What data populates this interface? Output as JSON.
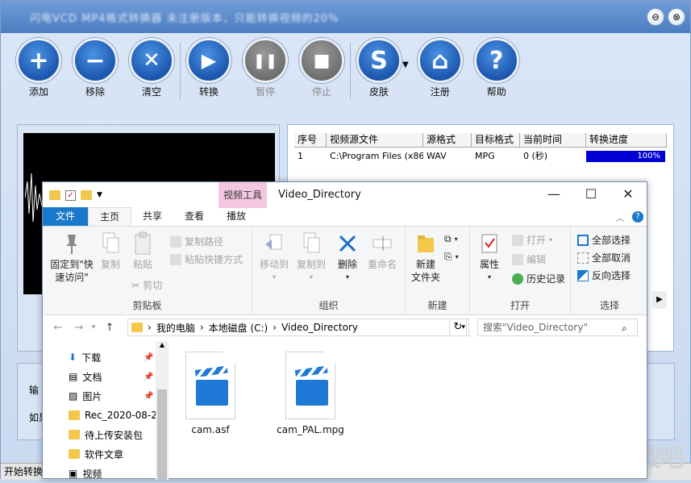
{
  "app": {
    "title": "闪电VCD MP4格式转换器 未注册版本，只能转换视频的20%",
    "close_min": "⊖",
    "close_x": "⊗"
  },
  "toolbar": [
    {
      "label": "添加",
      "glyph": "+",
      "disabled": false
    },
    {
      "label": "移除",
      "glyph": "−",
      "disabled": false
    },
    {
      "label": "清空",
      "glyph": "✕",
      "disabled": false
    },
    {
      "label": "转换",
      "glyph": "▶",
      "disabled": false
    },
    {
      "label": "暂停",
      "glyph": "❚❚",
      "disabled": true
    },
    {
      "label": "停止",
      "glyph": "■",
      "disabled": true
    },
    {
      "label": "皮肤",
      "glyph": "S",
      "disabled": false
    },
    {
      "label": "注册",
      "glyph": "⌂",
      "disabled": false
    },
    {
      "label": "帮助",
      "glyph": "?",
      "disabled": false
    }
  ],
  "table": {
    "headers": [
      "序号",
      "视频源文件",
      "源格式",
      "目标格式",
      "当前时间",
      "转换进度"
    ],
    "rows": [
      {
        "no": "1",
        "src": "C:\\Program Files (x86)...",
        "srcfmt": "WAV",
        "dstfmt": "MPG",
        "time": "0 (秒)",
        "progress": "100%",
        "progress_value": 1.0
      }
    ]
  },
  "bottom": {
    "label1": "输",
    "label2": "如果"
  },
  "status": {
    "text": "开始转换"
  },
  "explorer": {
    "context_tab": "视频工具",
    "folder_title": "Video_Directory",
    "tabs": [
      "文件",
      "主页",
      "共享",
      "查看",
      "播放"
    ],
    "ribbon": {
      "pin": "固定到\"快\n速访问\"",
      "copy": "复制",
      "paste": "粘贴",
      "copy_path": "复制路径",
      "paste_shortcut": "粘贴快捷方式",
      "cut": "剪切",
      "clipboard": "剪贴板",
      "move_to": "移动到",
      "copy_to": "复制到",
      "delete": "删除",
      "rename": "重命名",
      "organize": "组织",
      "new_folder": "新建\n文件夹",
      "new": "新建",
      "properties": "属性",
      "open": "打开",
      "edit": "编辑",
      "history": "历史记录",
      "open_group": "打开",
      "select_all": "全部选择",
      "select_none": "全部取消",
      "invert": "反向选择",
      "select": "选择"
    },
    "path": [
      "我的电脑",
      "本地磁盘 (C:)",
      "Video_Directory"
    ],
    "search_placeholder": "搜索\"Video_Directory\"",
    "nav": [
      {
        "label": "下载",
        "pinned": true,
        "icon": "download-icon"
      },
      {
        "label": "文档",
        "pinned": true,
        "icon": "document-icon"
      },
      {
        "label": "图片",
        "pinned": true,
        "icon": "picture-icon"
      },
      {
        "label": "Rec_2020-08-2",
        "pinned": false,
        "icon": "folder-icon"
      },
      {
        "label": "待上传安装包",
        "pinned": false,
        "icon": "folder-icon"
      },
      {
        "label": "软件文章",
        "pinned": false,
        "icon": "folder-icon"
      },
      {
        "label": "视频",
        "pinned": false,
        "icon": "video-icon"
      }
    ],
    "files": [
      "cam.asf",
      "cam_PAL.mpg"
    ]
  },
  "watermark": "下载吧"
}
